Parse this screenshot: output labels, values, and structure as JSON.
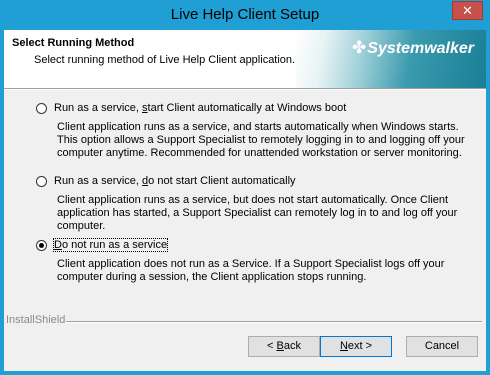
{
  "window": {
    "title": "Live Help Client Setup",
    "close_glyph": "✕"
  },
  "banner": {
    "title": "Select Running Method",
    "subtitle": "Select running method of Live Help Client application.",
    "logo_mark": "✤",
    "logo_text": "Systemwalker"
  },
  "options": [
    {
      "label_pre": "Run as a service, ",
      "label_u": "s",
      "label_post": "tart Client automatically at Windows boot",
      "selected": false,
      "description": "Client application runs as a service, and starts automatically when Windows starts. This option allows a Support Specialist to remotely logging in to and logging off your computer anytime. Recommended for unattended workstation or server monitoring."
    },
    {
      "label_pre": "Run as a service, ",
      "label_u": "d",
      "label_post": "o not start Client automatically",
      "selected": false,
      "description": "Client application runs as a service, but does not start automatically. Once Client application has started, a Support Specialist can remotely log in to and log off your computer."
    },
    {
      "label_pre": "",
      "label_u": "D",
      "label_post": "o not run as a service",
      "selected": true,
      "description": "Client application does not run as a Service. If a Support Specialist logs off your computer during a session, the Client application stops running."
    }
  ],
  "footer": {
    "brand": "InstallShield"
  },
  "buttons": {
    "back_pre": "< ",
    "back_u": "B",
    "back_post": "ack",
    "next_pre": "",
    "next_u": "N",
    "next_post": "ext >",
    "cancel": "Cancel"
  },
  "colors": {
    "titlebar": "#1f9fd4",
    "close_button": "#c7504a",
    "dialog_bg": "#f0f0f0",
    "default_button_border": "#0078d7"
  }
}
